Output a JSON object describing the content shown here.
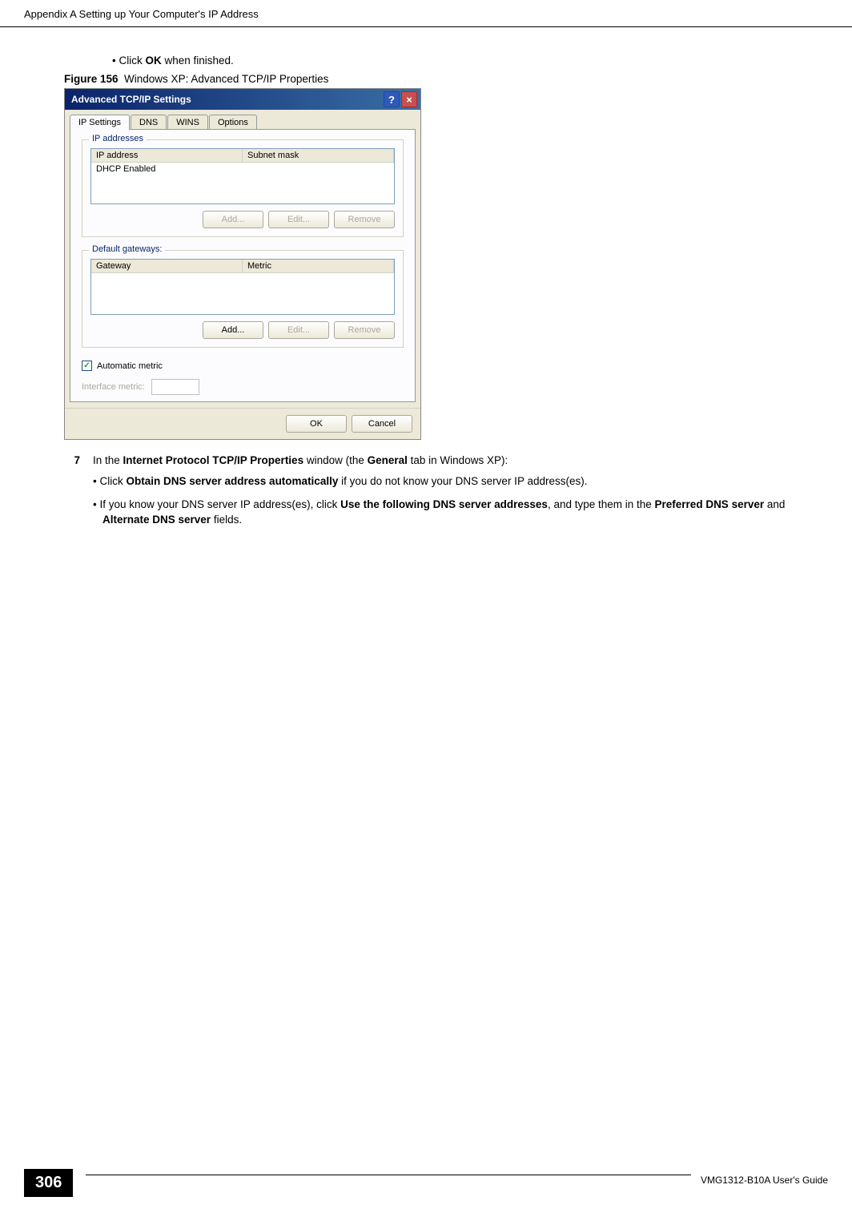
{
  "header": {
    "title": "Appendix A Setting up Your Computer's IP Address"
  },
  "intro_bullet": {
    "prefix": "Click ",
    "bold": "OK",
    "suffix": " when finished."
  },
  "figure": {
    "label": "Figure 156",
    "caption": "Windows XP: Advanced TCP/IP Properties"
  },
  "dialog": {
    "title": "Advanced TCP/IP Settings",
    "tabs": [
      "IP Settings",
      "DNS",
      "WINS",
      "Options"
    ],
    "ip_group": {
      "title": "IP addresses",
      "col1": "IP address",
      "col2": "Subnet mask",
      "row": "DHCP Enabled"
    },
    "gw_group": {
      "title": "Default gateways:",
      "col1": "Gateway",
      "col2": "Metric"
    },
    "buttons": {
      "add": "Add...",
      "edit": "Edit...",
      "remove": "Remove"
    },
    "auto_metric": "Automatic metric",
    "interface_metric": "Interface metric:",
    "ok": "OK",
    "cancel": "Cancel"
  },
  "step7": {
    "num": "7",
    "text_parts": [
      "In the ",
      "Internet Protocol TCP/IP Properties",
      " window (the ",
      "General",
      " tab in Windows XP):"
    ]
  },
  "bullets": {
    "b1": {
      "p": [
        "Click ",
        "Obtain DNS server address automatically",
        " if you do not know your DNS server IP address(es)."
      ]
    },
    "b2": {
      "p": [
        "If you know your DNS server IP address(es), click ",
        "Use the following DNS server addresses",
        ", and type them in the ",
        "Preferred DNS server",
        " and ",
        "Alternate DNS server",
        " fields."
      ]
    }
  },
  "footer": {
    "page": "306",
    "guide": "VMG1312-B10A User's Guide"
  }
}
